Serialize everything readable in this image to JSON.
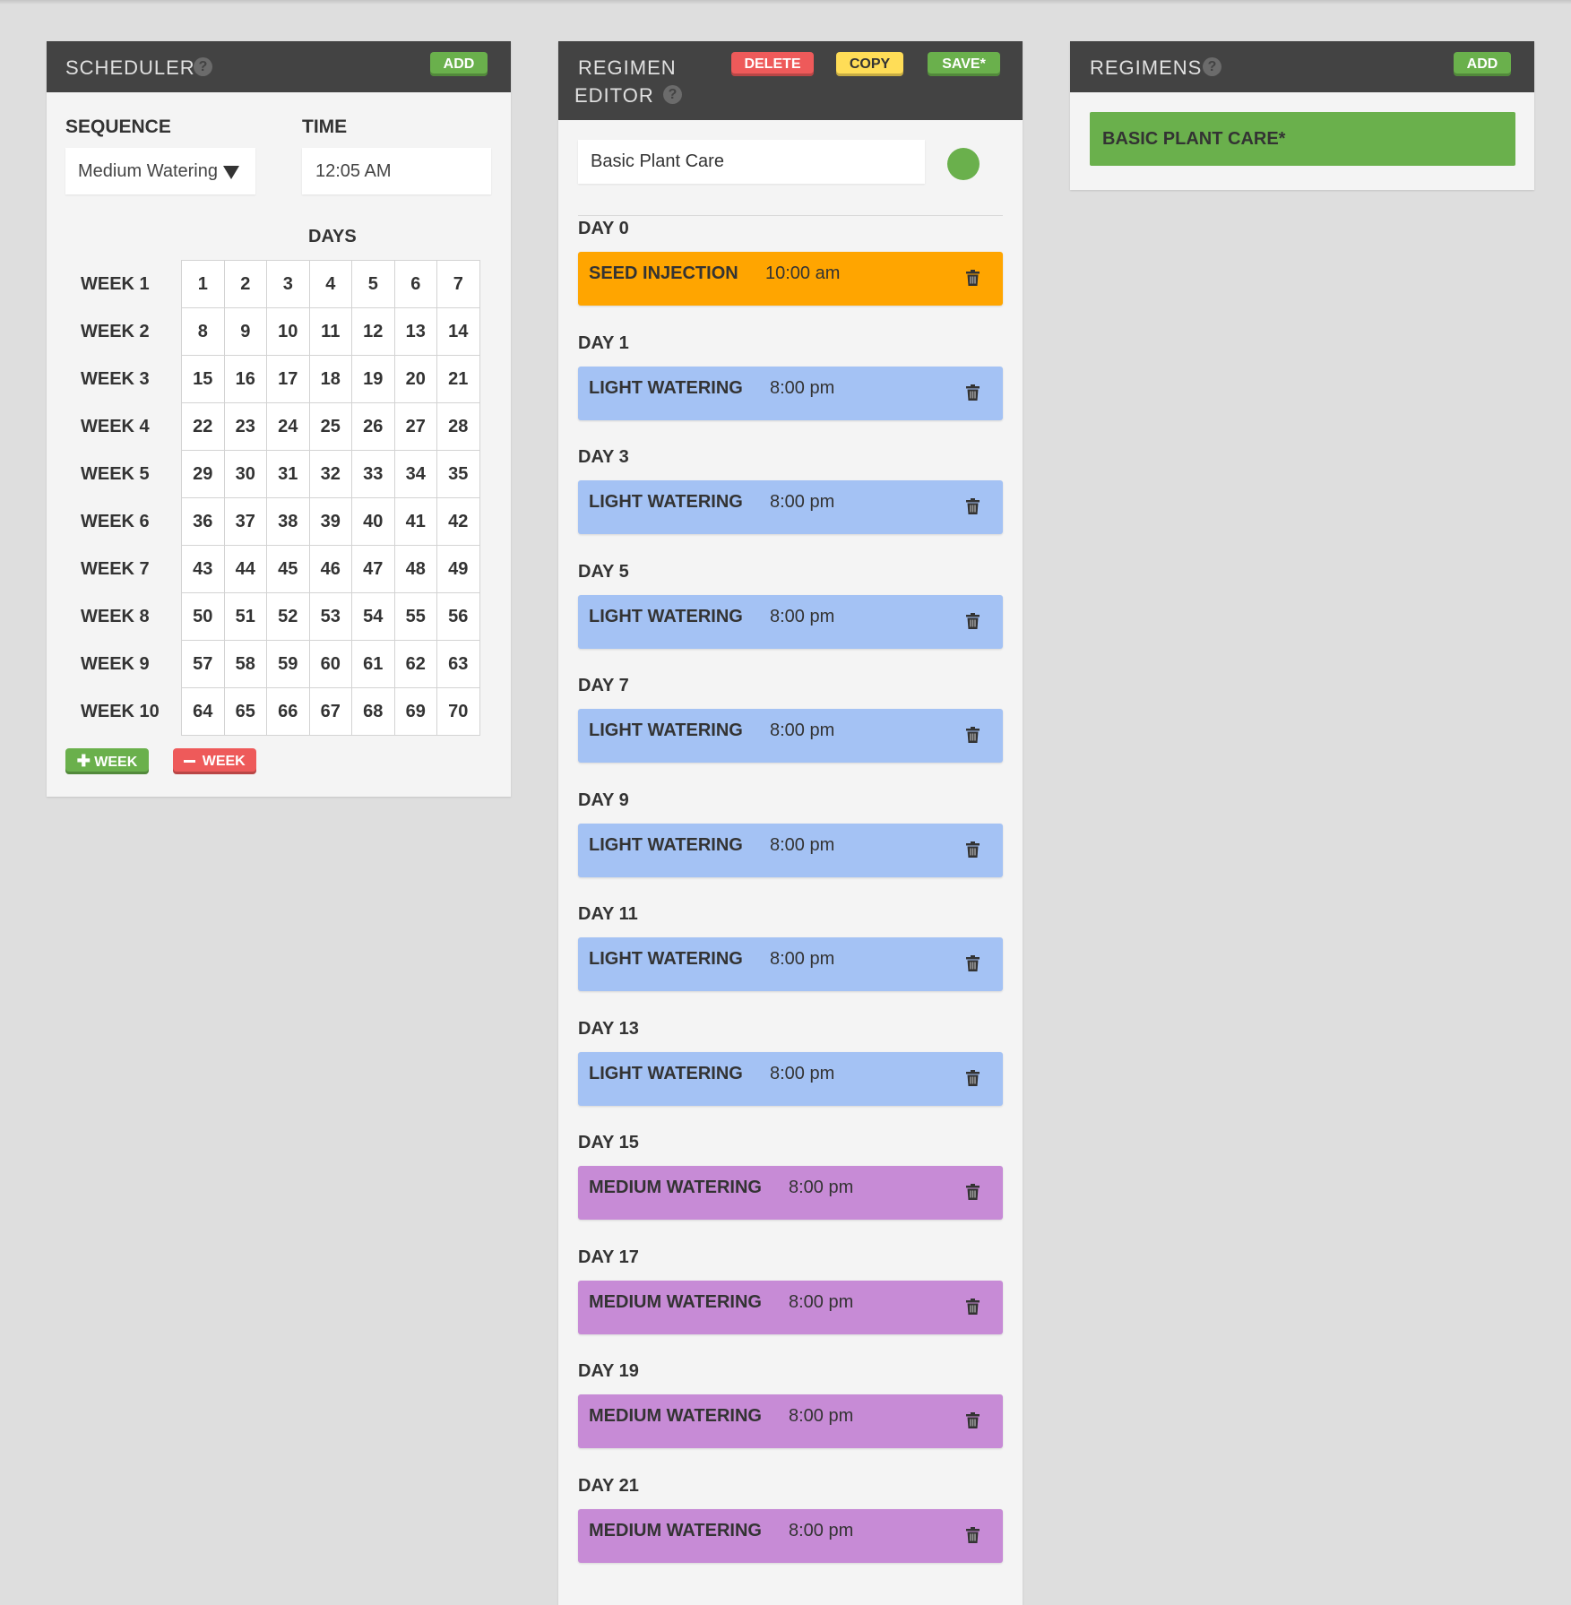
{
  "scheduler": {
    "title": "SCHEDULER",
    "help": "?",
    "add_label": "ADD",
    "sequence_label": "SEQUENCE",
    "sequence_value": "Medium Watering",
    "time_label": "TIME",
    "time_value": "12:05 AM",
    "days_label": "DAYS",
    "weeks": [
      {
        "label": "WEEK 1",
        "days": [
          "1",
          "2",
          "3",
          "4",
          "5",
          "6",
          "7"
        ]
      },
      {
        "label": "WEEK 2",
        "days": [
          "8",
          "9",
          "10",
          "11",
          "12",
          "13",
          "14"
        ]
      },
      {
        "label": "WEEK 3",
        "days": [
          "15",
          "16",
          "17",
          "18",
          "19",
          "20",
          "21"
        ]
      },
      {
        "label": "WEEK 4",
        "days": [
          "22",
          "23",
          "24",
          "25",
          "26",
          "27",
          "28"
        ]
      },
      {
        "label": "WEEK 5",
        "days": [
          "29",
          "30",
          "31",
          "32",
          "33",
          "34",
          "35"
        ]
      },
      {
        "label": "WEEK 6",
        "days": [
          "36",
          "37",
          "38",
          "39",
          "40",
          "41",
          "42"
        ]
      },
      {
        "label": "WEEK 7",
        "days": [
          "43",
          "44",
          "45",
          "46",
          "47",
          "48",
          "49"
        ]
      },
      {
        "label": "WEEK 8",
        "days": [
          "50",
          "51",
          "52",
          "53",
          "54",
          "55",
          "56"
        ]
      },
      {
        "label": "WEEK 9",
        "days": [
          "57",
          "58",
          "59",
          "60",
          "61",
          "62",
          "63"
        ]
      },
      {
        "label": "WEEK 10",
        "days": [
          "64",
          "65",
          "66",
          "67",
          "68",
          "69",
          "70"
        ]
      }
    ],
    "add_week_label": "WEEK",
    "remove_week_label": "WEEK"
  },
  "editor": {
    "title_line1": "REGIMEN",
    "title_line2": "EDITOR",
    "help": "?",
    "delete_label": "DELETE",
    "copy_label": "COPY",
    "save_label": "SAVE*",
    "name_value": "Basic Plant Care",
    "color": "#6ab04c",
    "items": [
      {
        "day": "DAY 0",
        "name": "SEED INJECTION",
        "time": "10:00 am",
        "color": "#ffa500"
      },
      {
        "day": "DAY 1",
        "name": "LIGHT WATERING",
        "time": "8:00 pm",
        "color": "#a4c2f4"
      },
      {
        "day": "DAY 3",
        "name": "LIGHT WATERING",
        "time": "8:00 pm",
        "color": "#a4c2f4"
      },
      {
        "day": "DAY 5",
        "name": "LIGHT WATERING",
        "time": "8:00 pm",
        "color": "#a4c2f4"
      },
      {
        "day": "DAY 7",
        "name": "LIGHT WATERING",
        "time": "8:00 pm",
        "color": "#a4c2f4"
      },
      {
        "day": "DAY 9",
        "name": "LIGHT WATERING",
        "time": "8:00 pm",
        "color": "#a4c2f4"
      },
      {
        "day": "DAY 11",
        "name": "LIGHT WATERING",
        "time": "8:00 pm",
        "color": "#a4c2f4"
      },
      {
        "day": "DAY 13",
        "name": "LIGHT WATERING",
        "time": "8:00 pm",
        "color": "#a4c2f4"
      },
      {
        "day": "DAY 15",
        "name": "MEDIUM WATERING",
        "time": "8:00 pm",
        "color": "#c78bd6"
      },
      {
        "day": "DAY 17",
        "name": "MEDIUM WATERING",
        "time": "8:00 pm",
        "color": "#c78bd6"
      },
      {
        "day": "DAY 19",
        "name": "MEDIUM WATERING",
        "time": "8:00 pm",
        "color": "#c78bd6"
      },
      {
        "day": "DAY 21",
        "name": "MEDIUM WATERING",
        "time": "8:00 pm",
        "color": "#c78bd6"
      }
    ]
  },
  "regimens": {
    "title": "REGIMENS",
    "help": "?",
    "add_label": "ADD",
    "items": [
      {
        "name": "BASIC PLANT CARE*",
        "color": "#6ab04c"
      }
    ]
  }
}
